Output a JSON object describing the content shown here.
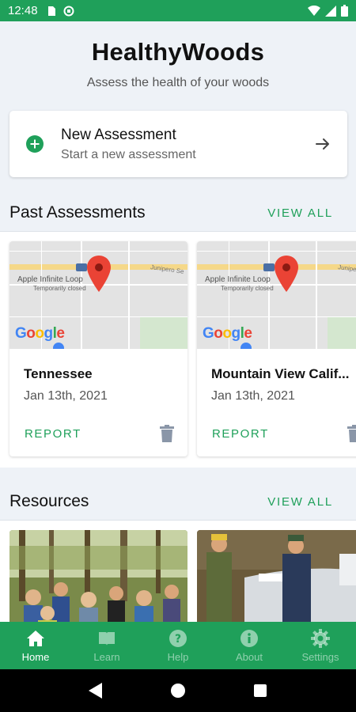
{
  "status_bar": {
    "time": "12:48"
  },
  "header": {
    "title": "HealthyWoods",
    "subtitle": "Assess the health of your woods"
  },
  "new_assessment": {
    "title": "New Assessment",
    "subtitle": "Start a new assessment"
  },
  "past_assessments": {
    "title": "Past Assessments",
    "view_all": "VIEW ALL",
    "items": [
      {
        "name": "Tennessee",
        "date": "Jan 13th, 2021",
        "report": "REPORT",
        "map": {
          "place": "Apple Infinite Loop",
          "status": "Temporarily closed",
          "street": "Junipero Se",
          "brand": "Google"
        }
      },
      {
        "name": "Mountain View Calif...",
        "date": "Jan 13th, 2021",
        "report": "REPORT",
        "map": {
          "place": "Apple Infinite Loop",
          "status": "Temporarily closed",
          "street": "Junipero Se",
          "brand": "Google"
        }
      }
    ]
  },
  "resources": {
    "title": "Resources",
    "view_all": "VIEW ALL"
  },
  "bottom_nav": [
    {
      "label": "Home",
      "icon": "home-icon",
      "active": true
    },
    {
      "label": "Learn",
      "icon": "book-icon",
      "active": false
    },
    {
      "label": "Help",
      "icon": "help-icon",
      "active": false
    },
    {
      "label": "About",
      "icon": "info-icon",
      "active": false
    },
    {
      "label": "Settings",
      "icon": "gear-icon",
      "active": false
    }
  ],
  "colors": {
    "primary": "#1fa05a",
    "background": "#eef2f7"
  }
}
